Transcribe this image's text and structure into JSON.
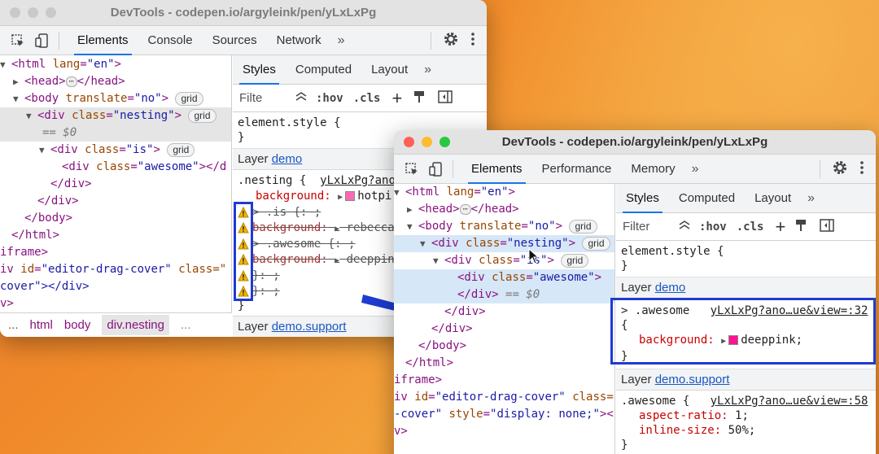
{
  "colors": {
    "accent": "#1a73e8",
    "highlight_box": "#1f3bd1",
    "swatch_hotpink": "#ff69b4",
    "swatch_deeppink": "#ff1493",
    "mac_red": "#ff5f57",
    "mac_yellow": "#febc2e",
    "mac_green": "#28c840"
  },
  "win1": {
    "title": "DevTools - codepen.io/argyleink/pen/yLxLxPg",
    "tabs": [
      "Elements",
      "Console",
      "Sources",
      "Network"
    ],
    "more": "»",
    "icons": [
      "inspect-icon",
      "device-icon",
      "gear-icon",
      "kebab-menu-icon"
    ],
    "dom": {
      "l1_tag": "<html",
      "l1_attr": "lang",
      "l1_val": "\"en\"",
      "l1_end": ">",
      "l2_open": "<head>",
      "l2_close": "</head>",
      "l3_tag": "<body",
      "l3_attr": "translate",
      "l3_val": "\"no\"",
      "l3_end": ">",
      "l3_badge": "grid",
      "l4_tag": "<div",
      "l4_attr": "class",
      "l4_val": "\"nesting\"",
      "l4_end": ">",
      "l4_badge": "grid",
      "l5": "== $0",
      "l6_tag": "<div",
      "l6_attr": "class",
      "l6_val": "\"is\"",
      "l6_end": ">",
      "l6_badge": "grid",
      "l7_tag": "<div",
      "l7_attr": "class",
      "l7_val": "\"awesome\"",
      "l7_end": "></d",
      "l8": "</div>",
      "l9": "</div>",
      "l10": "</body>",
      "l11": "</html>",
      "l12": "iframe>",
      "l13_tag": "iv",
      "l13_attr": "id",
      "l13_val": "\"editor-drag-cover\"",
      "l13_attr2": "class=\"",
      "l14": "cover\"></div>",
      "l15": "v>"
    },
    "crumbs": [
      "...",
      "html",
      "body",
      "div.nesting",
      "..."
    ],
    "styles": {
      "tabs": [
        "Styles",
        "Computed",
        "Layout"
      ],
      "more": "»",
      "filter_placeholder": "Filte",
      "hov": ":hov",
      "cls": ".cls",
      "plus": "+",
      "element_style": "element.style {",
      "close_brace": "}",
      "layer1_label": "Layer",
      "layer1_link": "demo",
      "rule_selector": ".nesting {",
      "rule_source": "yLxLxPg?ano",
      "decl_bg_prop": "background:",
      "decl_bg_val": "hotpi",
      "s1": "> .is {: ;",
      "s2_prop": "background:",
      "s2_val": "rebecca",
      "s3": "> .awesome {: ;",
      "s4_prop": "background:",
      "s4_val": "deeppin",
      "s5": "}: ;",
      "s6": "}: ;",
      "s7": "}",
      "layer2_label": "Layer",
      "layer2_link": "demo.support"
    }
  },
  "win2": {
    "title": "DevTools - codepen.io/argyleink/pen/yLxLxPg",
    "tabs": [
      "Elements",
      "Performance",
      "Memory"
    ],
    "more": "»",
    "dom": {
      "l1_tag": "<html",
      "l1_attr": "lang",
      "l1_val": "\"en\"",
      "l1_end": ">",
      "l2_open": "<head>",
      "l2_close": "</head>",
      "l3_tag": "<body",
      "l3_attr": "translate",
      "l3_val": "\"no\"",
      "l3_end": ">",
      "l3_badge": "grid",
      "l4_tag": "<div",
      "l4_attr": "class",
      "l4_val": "\"nesting\"",
      "l4_end": ">",
      "l4_badge": "grid",
      "l5_tag": "<div",
      "l5_attr": "class",
      "l5_val": "\"is\"",
      "l5_end": ">",
      "l5_badge": "grid",
      "l6_tag": "<div",
      "l6_attr": "class",
      "l6_val": "\"awesome\"",
      "l6_end": ">",
      "l7": "</div>",
      "l7_dim": "== $0",
      "l8": "</div>",
      "l9": "</div>",
      "l10": "</body>",
      "l11": "</html>",
      "l12": "iframe>",
      "l13_tag": "iv",
      "l13_attr": "id",
      "l13_val": "\"editor-drag-cover\"",
      "l13_attr2": "class=",
      "l14_val": "-cover\"",
      "l14_attr": "style",
      "l14_val2": "\"display: none;\"",
      "l14_end": "><",
      "l15": "v>"
    },
    "styles": {
      "tabs": [
        "Styles",
        "Computed",
        "Layout"
      ],
      "more": "»",
      "filter_placeholder": "Filter",
      "hov": ":hov",
      "cls": ".cls",
      "plus": "+",
      "element_style": "element.style {",
      "close_brace": "}",
      "layer1_label": "Layer",
      "layer1_link": "demo",
      "r1_selector": "> .awesome",
      "r1_source": "yLxLxPg?ano…ue&view=:32",
      "r1_open": "{",
      "r1_prop": "background:",
      "r1_val": "deeppink;",
      "r1_close": "}",
      "layer2_label": "Layer",
      "layer2_link": "demo.support",
      "r2_selector": ".awesome {",
      "r2_source": "yLxLxPg?ano…ue&view=:58",
      "r2_p1": "aspect-ratio:",
      "r2_v1": "1;",
      "r2_p2": "inline-size:",
      "r2_v2": "50%;",
      "r2_close": "}"
    }
  }
}
